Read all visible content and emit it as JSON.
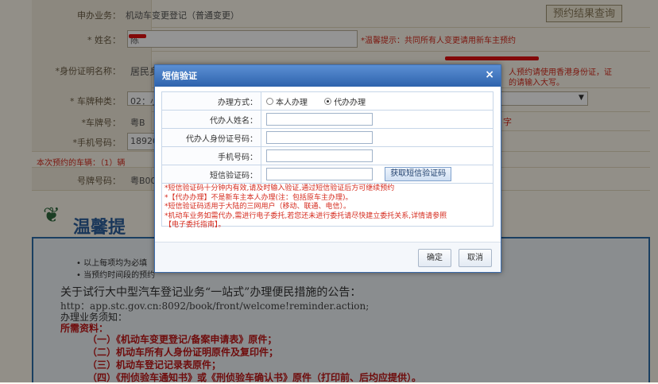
{
  "background_form": {
    "rows": [
      {
        "label": "申办业务：",
        "value": "机动车变更登记（普通变更）"
      },
      {
        "label": "* 姓名：",
        "value": "陈"
      },
      {
        "label": "*身份证明名称：",
        "value": "居民身"
      },
      {
        "label": "* 车牌种类：",
        "value": "02：小"
      },
      {
        "label": "*车牌号：",
        "value": "粤B"
      },
      {
        "label": "*手机号码：",
        "value": "18920"
      },
      {
        "label": "号牌号码：",
        "value": "粤B00A"
      }
    ],
    "query_button": "预约结果查询",
    "warm_tip": "*温馨提示：共同所有人变更请用新车主预约",
    "id_tip_line1": "人预约请使用香港身份证，证",
    "id_tip_line2": "的请输入大写。",
    "plate_tip": "字",
    "booked_count": "本次预约的车辆：（1）辆"
  },
  "notice_panel": {
    "heading": "温馨提",
    "bullet1": "以上每项均为必填",
    "bullet2": "当预约时间段的预约",
    "announcement": "关于试行大中型汽车登记业务“一站式”办理便民措施的公告：",
    "link": "http：app.stc.gov.cn:8092/book/front/welcome!reminder.action;",
    "line_notice": "办理业务须知：",
    "line_materials": "所需资料：",
    "items": [
      "（一）《机动车变更登记/备案申请表》原件；",
      "（二）机动车所有人身份证明原件及复印件；",
      "（三）机动车登记记录表原件；",
      "（四）《刑侦验车通知书》或《刑侦验车确认书》原件（打印前、后均应提供）。"
    ]
  },
  "dialog": {
    "title": "短信验证",
    "close_symbol": "×",
    "fields": {
      "method_label": "办理方式：",
      "method_options": [
        "本人办理",
        "代办办理"
      ],
      "method_selected": "代办办理",
      "agent_name_label": "代办人姓名：",
      "agent_name_value": "",
      "agent_id_label": "代办人身份证号码：",
      "agent_id_value": "",
      "phone_label": "手机号码：",
      "phone_value": "",
      "sms_code_label": "短信验证码：",
      "sms_code_value": "",
      "get_code_button": "获取短信验证码"
    },
    "notes": [
      "*短信验证码十分钟内有效,请及时输入验证,通过短信验证后方可继续预约",
      "*【代办办理】不是新车主本人办理(注：包括原车主办理)。",
      "*短信验证码适用于大陆的三网用户（移动、联通、电信）。",
      "*机动车业务如需代办,需进行电子委托,若您还未进行委托请尽快建立委托关系,详情请参照",
      "【电子委托指南】。"
    ],
    "confirm_button": "确定",
    "cancel_button": "取消"
  },
  "colors": {
    "dialog_title_bar": "#2e63ad",
    "warning_red": "#d52b1e",
    "overlay": "rgba(0,0,0,0.42)"
  }
}
